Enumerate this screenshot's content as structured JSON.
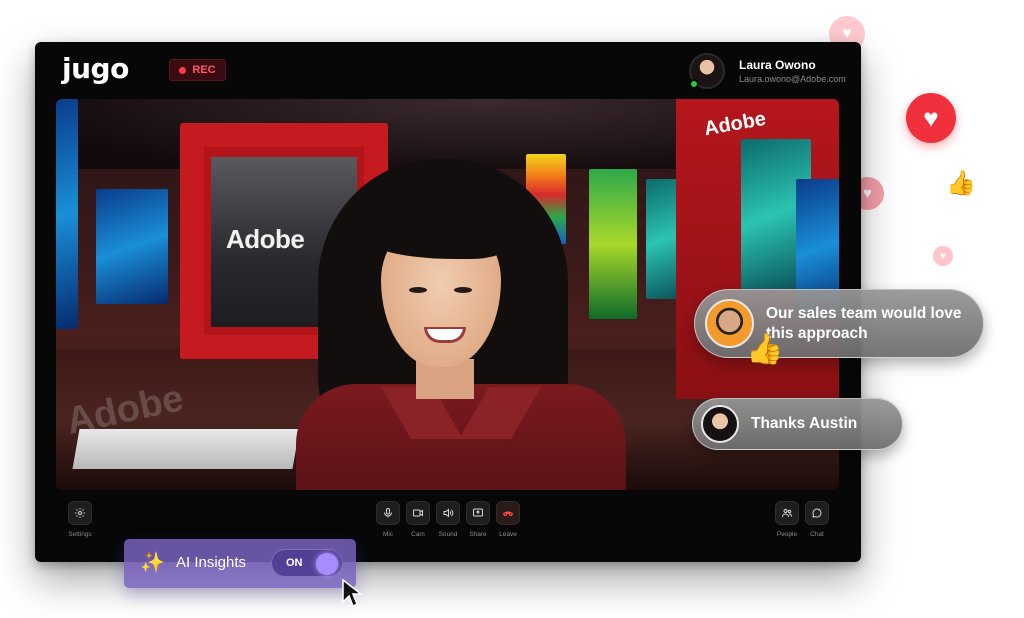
{
  "app": {
    "logo": "jugo"
  },
  "recording": {
    "label": "REC",
    "color": "#ff3b4a"
  },
  "user": {
    "name": "Laura Owono",
    "email": "Laura.owono@Adobe.com",
    "status": "online"
  },
  "stage": {
    "sign_left": "Adobe",
    "sign_right": "Adobe",
    "floor_sign": "Adobe"
  },
  "controls": {
    "settings": {
      "label": "Settings",
      "icon": "gear-icon"
    },
    "mic": {
      "label": "Mic",
      "icon": "mic-icon"
    },
    "cam": {
      "label": "Cam",
      "icon": "camera-icon"
    },
    "sound": {
      "label": "Sound",
      "icon": "speaker-icon"
    },
    "share": {
      "label": "Share",
      "icon": "share-screen-icon"
    },
    "leave": {
      "label": "Leave",
      "icon": "phone-hangup-icon"
    },
    "people": {
      "label": "People",
      "icon": "people-icon"
    },
    "chat": {
      "label": "Chat",
      "icon": "chat-icon"
    }
  },
  "messages": [
    {
      "text": "Our sales team would love this approach",
      "reaction": "thumbs-up"
    },
    {
      "text": "Thanks Austin"
    }
  ],
  "reactions": [
    "heart",
    "heart",
    "heart",
    "heart",
    "thumbs-up"
  ],
  "ai_insights": {
    "label": "AI Insights",
    "toggle_label": "ON",
    "enabled": true
  },
  "colors": {
    "accent": "#8b6cf0",
    "danger": "#ff4a4a",
    "brand_red": "#c41a20"
  }
}
